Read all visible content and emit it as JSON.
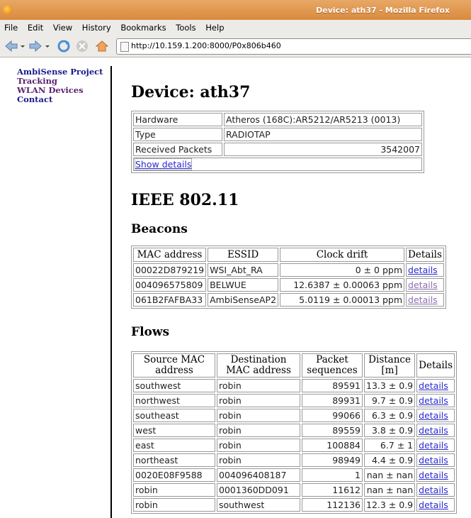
{
  "window": {
    "title": "Device: ath37 - Mozilla Firefox"
  },
  "menu": [
    "File",
    "Edit",
    "View",
    "History",
    "Bookmarks",
    "Tools",
    "Help"
  ],
  "nav": {
    "url": "http://10.159.1.200:8000/P0x806b460"
  },
  "sidebar": {
    "items": [
      {
        "label": "AmbiSense Project"
      },
      {
        "label": "Tracking"
      },
      {
        "label": "WLAN Devices"
      },
      {
        "label": "Contact"
      }
    ]
  },
  "device": {
    "title": "Device: ath37",
    "rows": [
      {
        "label": "Hardware",
        "value": "Atheros (168C):AR5212/AR5213 (0013)"
      },
      {
        "label": "Type",
        "value": "RADIOTAP"
      },
      {
        "label": "Received Packets",
        "value": "3542007"
      }
    ],
    "show_details": "Show details"
  },
  "ieee": {
    "heading": "IEEE 802.11"
  },
  "beacons": {
    "heading": "Beacons",
    "headers": [
      "MAC address",
      "ESSID",
      "Clock drift",
      "Details"
    ],
    "rows": [
      {
        "mac": "00022D879219",
        "essid": "WSI_Abt_RA",
        "drift": "0 ± 0 ppm",
        "details": "details"
      },
      {
        "mac": "004096575809",
        "essid": "BELWUE",
        "drift": "12.6387 ± 0.00063 ppm",
        "details": "details"
      },
      {
        "mac": "061B2FAFBA33",
        "essid": "AmbiSenseAP2",
        "drift": "5.0119 ± 0.00013 ppm",
        "details": "details"
      }
    ]
  },
  "flows": {
    "heading": "Flows",
    "headers": [
      "Source MAC address",
      "Destination MAC address",
      "Packet sequences",
      "Distance [m]",
      "Details"
    ],
    "rows": [
      {
        "src": "southwest",
        "dst": "robin",
        "seq": "89591",
        "dist": "13.3 ± 0.9",
        "details": "details"
      },
      {
        "src": "northwest",
        "dst": "robin",
        "seq": "89931",
        "dist": "9.7 ± 0.9",
        "details": "details"
      },
      {
        "src": "southeast",
        "dst": "robin",
        "seq": "99066",
        "dist": "6.3 ± 0.9",
        "details": "details"
      },
      {
        "src": "west",
        "dst": "robin",
        "seq": "89559",
        "dist": "3.8 ± 0.9",
        "details": "details"
      },
      {
        "src": "east",
        "dst": "robin",
        "seq": "100884",
        "dist": "6.7 ± 1",
        "details": "details"
      },
      {
        "src": "northeast",
        "dst": "robin",
        "seq": "98949",
        "dist": "4.4 ± 0.9",
        "details": "details"
      },
      {
        "src": "0020E08F9588",
        "dst": "004096408187",
        "seq": "1",
        "dist": "nan ± nan",
        "details": "details"
      },
      {
        "src": "robin",
        "dst": "0001360DD091",
        "seq": "11612",
        "dist": "nan ± nan",
        "details": "details"
      },
      {
        "src": "robin",
        "dst": "southwest",
        "seq": "112136",
        "dist": "12.3 ± 0.9",
        "details": "details"
      }
    ]
  }
}
